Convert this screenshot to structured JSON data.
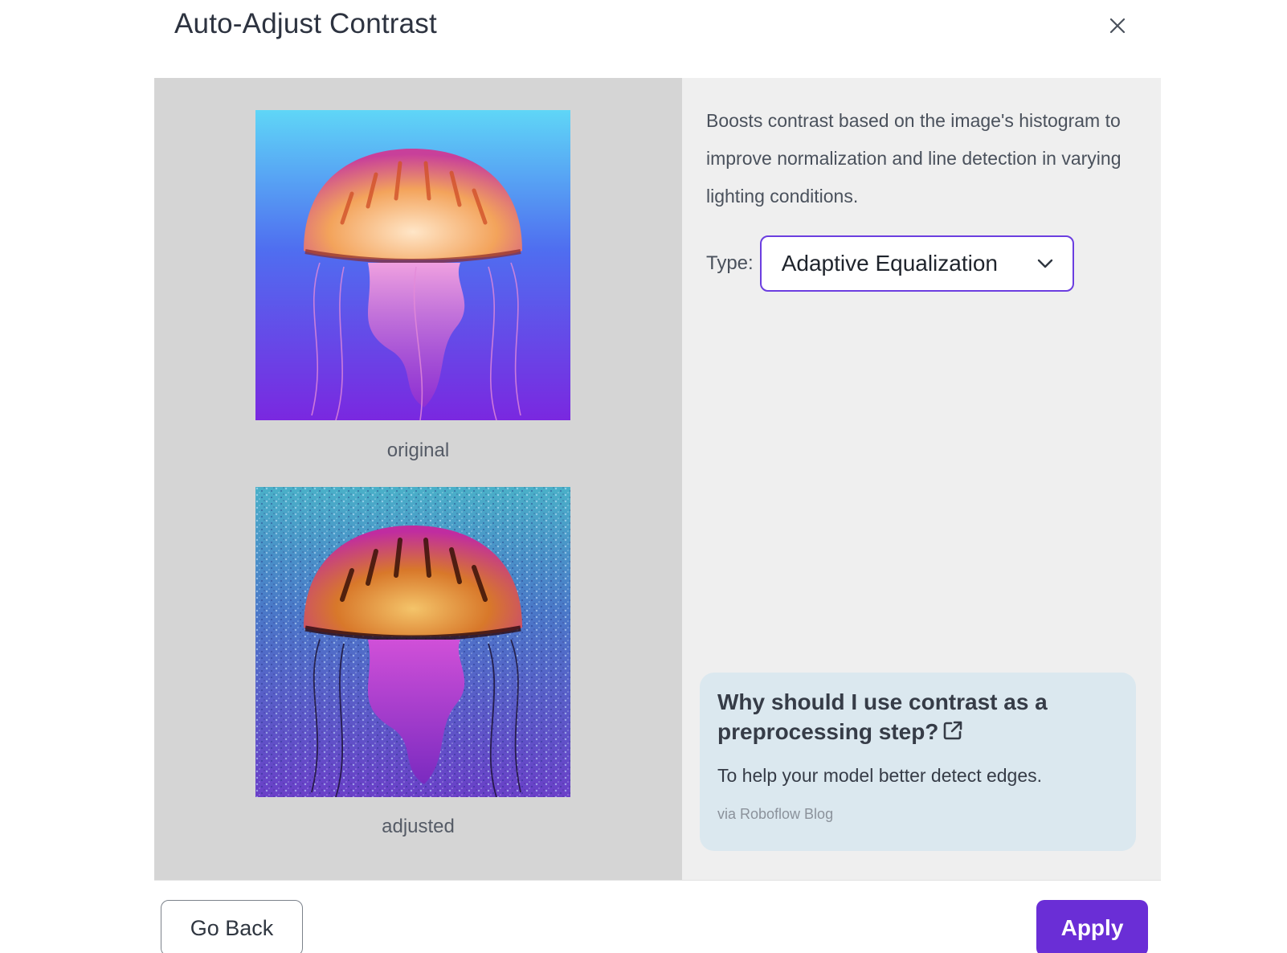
{
  "dialog": {
    "title": "Auto-Adjust Contrast"
  },
  "preview": {
    "original_caption": "original",
    "adjusted_caption": "adjusted"
  },
  "settings": {
    "description": "Boosts contrast based on the image's histogram to improve normalization and line detection in varying lighting conditions.",
    "type_label": "Type:",
    "type_value": "Adaptive Equalization"
  },
  "info": {
    "title": "Why should I use contrast as a preprocessing step?",
    "text": "To help your model better detect edges.",
    "source": "via Roboflow Blog"
  },
  "footer": {
    "back_label": "Go Back",
    "apply_label": "Apply"
  },
  "icons": {
    "close": "close-icon",
    "dropdown": "chevron-down-icon",
    "external_link": "external-link-icon"
  },
  "colors": {
    "accent": "#6a2ed6",
    "select_border": "#6b3ee0",
    "left_panel_bg": "#d5d5d5",
    "right_panel_bg": "#efefef",
    "info_card_bg": "#dbe8ef"
  }
}
